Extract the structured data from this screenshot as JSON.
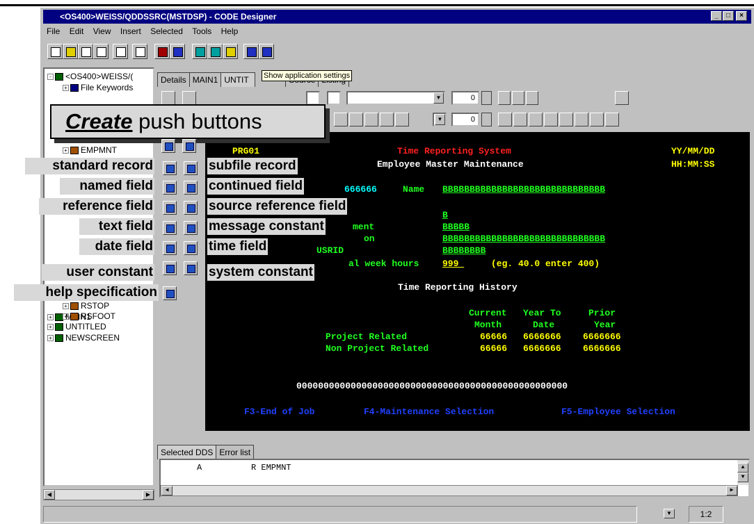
{
  "window": {
    "title": "<OS400>WEISS/QDDSSRC(MSTDSP) - CODE Designer",
    "minimize": "_",
    "maximize": "□",
    "close": "×"
  },
  "menu": [
    "File",
    "Edit",
    "View",
    "Insert",
    "Selected",
    "Tools",
    "Help"
  ],
  "tree": {
    "root": "<OS400>WEISS/(",
    "items": [
      "File Keywords",
      "EMPMNT",
      "MAIN1",
      "RSTOP",
      "RSFOOT",
      "UNTITLED",
      "NEWSCREEN"
    ]
  },
  "tabs": [
    "Details",
    "MAIN1",
    "UNTIT",
    "Source",
    "Listing"
  ],
  "tooltip": "Show application settings",
  "spin_values": [
    "0",
    "0"
  ],
  "callout": {
    "emph": "Create",
    "rest": " push buttons"
  },
  "palette": {
    "left_labels": [
      "standard record",
      "named field",
      "reference field",
      "text field",
      "date field",
      "user constant",
      "help specification"
    ],
    "right_labels": [
      "subfile record",
      "continued field",
      "source reference field",
      "message constant",
      "time field",
      "system constant"
    ]
  },
  "screen": {
    "prog": "PRG01",
    "sys_title": "Time Reporting System",
    "subtitle": "Employee Master Maintenance",
    "date": "YY/MM/DD",
    "time": "HH:MM:SS",
    "empno": "666666",
    "name_label": "Name",
    "name_value": "BBBBBBBBBBBBBBBBBBBBBBBBBBBBBB",
    "f1_value": "B",
    "dept_label": "ment",
    "dept_value": "BBBBB",
    "loc_label": "on",
    "loc_value": "BBBBBBBBBBBBBBBBBBBBBBBBBBBBBB",
    "usrid_label": "USRID",
    "usrid_value": "BBBBBBBB",
    "hours_label": "al week hours",
    "hours_value": "999 ",
    "hours_hint": "(eg. 40.0 enter 400)",
    "history_title": "Time Reporting History",
    "col1": [
      "Current",
      "Month"
    ],
    "col2": [
      "Year To",
      "Date"
    ],
    "col3": [
      "Prior",
      "Year"
    ],
    "rows": [
      {
        "label": "Project Related",
        "v1": "66666",
        "v2": "6666666",
        "v3": "6666666"
      },
      {
        "label": "Non Project Related",
        "v1": "66666",
        "v2": "6666666",
        "v3": "6666666"
      }
    ],
    "message": "00000000000000000000000000000000000000000000000000",
    "fkeys": [
      "F3-End of Job",
      "F4-Maintenance Selection",
      "F5-Employee Selection"
    ]
  },
  "bottom_tabs": [
    "Selected DDS",
    "Error list"
  ],
  "dds_line": {
    "col_a": "A",
    "col_r": "R EMPMNT"
  },
  "status": {
    "position": "1:2"
  },
  "colors": {
    "titlebar": "#000080",
    "screen_bg": "#000000",
    "callout_bg": "#d8d8d8"
  }
}
